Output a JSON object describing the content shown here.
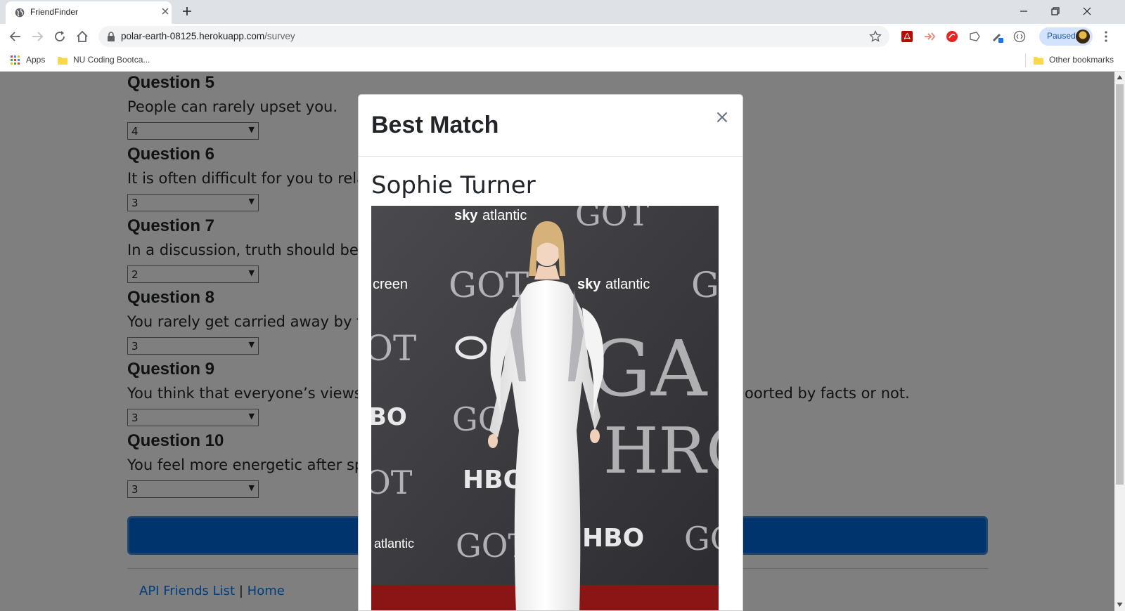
{
  "browser": {
    "tab_title": "FriendFinder",
    "url_host": "polar-earth-08125.herokuapp.com",
    "url_path": "/survey",
    "profile_status": "Paused",
    "bookmarks": {
      "apps_label": "Apps",
      "folder_label": "NU Coding Bootca...",
      "other_label": "Other bookmarks"
    }
  },
  "survey": {
    "questions": [
      {
        "heading": "Question 5",
        "text": "People can rarely upset you.",
        "value": "4"
      },
      {
        "heading": "Question 6",
        "text": "It is often difficult for you to relat",
        "value": "3"
      },
      {
        "heading": "Question 7",
        "text": "In a discussion, truth should be m",
        "value": "2"
      },
      {
        "heading": "Question 8",
        "text": "You rarely get carried away by fa",
        "value": "3"
      },
      {
        "heading": "Question 9",
        "text": "You think that everyone’s views s",
        "text_right": "oorted by facts or not.",
        "value": "3"
      },
      {
        "heading": "Question 10",
        "text": "You feel more energetic after spe",
        "value": "3"
      }
    ],
    "footer": {
      "link_api": "API Friends List",
      "separator": "|",
      "link_home": "Home"
    }
  },
  "modal": {
    "title": "Best Match",
    "close_glyph": "×",
    "match_name": "Sophie Turner"
  },
  "colors": {
    "primary": "#0069d9",
    "link": "#007bff"
  }
}
